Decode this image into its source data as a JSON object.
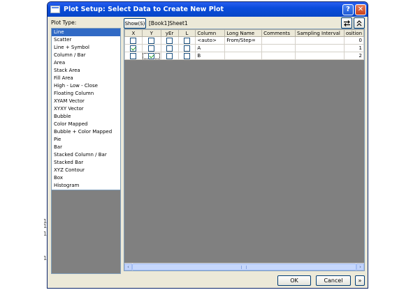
{
  "window": {
    "title": "Plot Setup: Select Data to Create New Plot",
    "help_label": "?",
    "close_label": "✕"
  },
  "background": {
    "marks": [
      "1",
      "1",
      "1",
      "1"
    ]
  },
  "plot_type_label": "Plot Type:",
  "plot_types": [
    "Line",
    "Scatter",
    "Line + Symbol",
    "Column / Bar",
    "Area",
    "Stack Area",
    "Fill Area",
    "High - Low - Close",
    "Floating Column",
    "XYAM Vector",
    "XYXY Vector",
    "Bubble",
    "Color Mapped",
    "Bubble + Color Mapped",
    "Pie",
    "Bar",
    "Stacked Column / Bar",
    "Stacked Bar",
    "XYZ Contour",
    "Box",
    "Histogram"
  ],
  "selected_plot_type": "Line",
  "toolbar": {
    "show_label": "Show(S)",
    "dataset": "[Book1]Sheet1",
    "swap_icon": "swap-arrows-icon",
    "collapse_icon": "double-chevron-up-icon"
  },
  "grid": {
    "columns": [
      "X",
      "Y",
      "yEr",
      "L",
      "Column",
      "Long Name",
      "Comments",
      "Sampling Interval",
      "osition"
    ],
    "rows": [
      {
        "x": false,
        "y": false,
        "yer": false,
        "l": false,
        "column": "<auto>",
        "long_name": "From/Step=",
        "comments": "",
        "sampling": "",
        "position": "0"
      },
      {
        "x": true,
        "y": false,
        "yer": false,
        "l": false,
        "column": "A",
        "long_name": "",
        "comments": "",
        "sampling": "",
        "position": "1"
      },
      {
        "x": false,
        "y": true,
        "yer": false,
        "l": false,
        "column": "B",
        "long_name": "",
        "comments": "",
        "sampling": "",
        "position": "2"
      }
    ]
  },
  "buttons": {
    "ok": "OK",
    "cancel": "Cancel",
    "more": "»"
  }
}
